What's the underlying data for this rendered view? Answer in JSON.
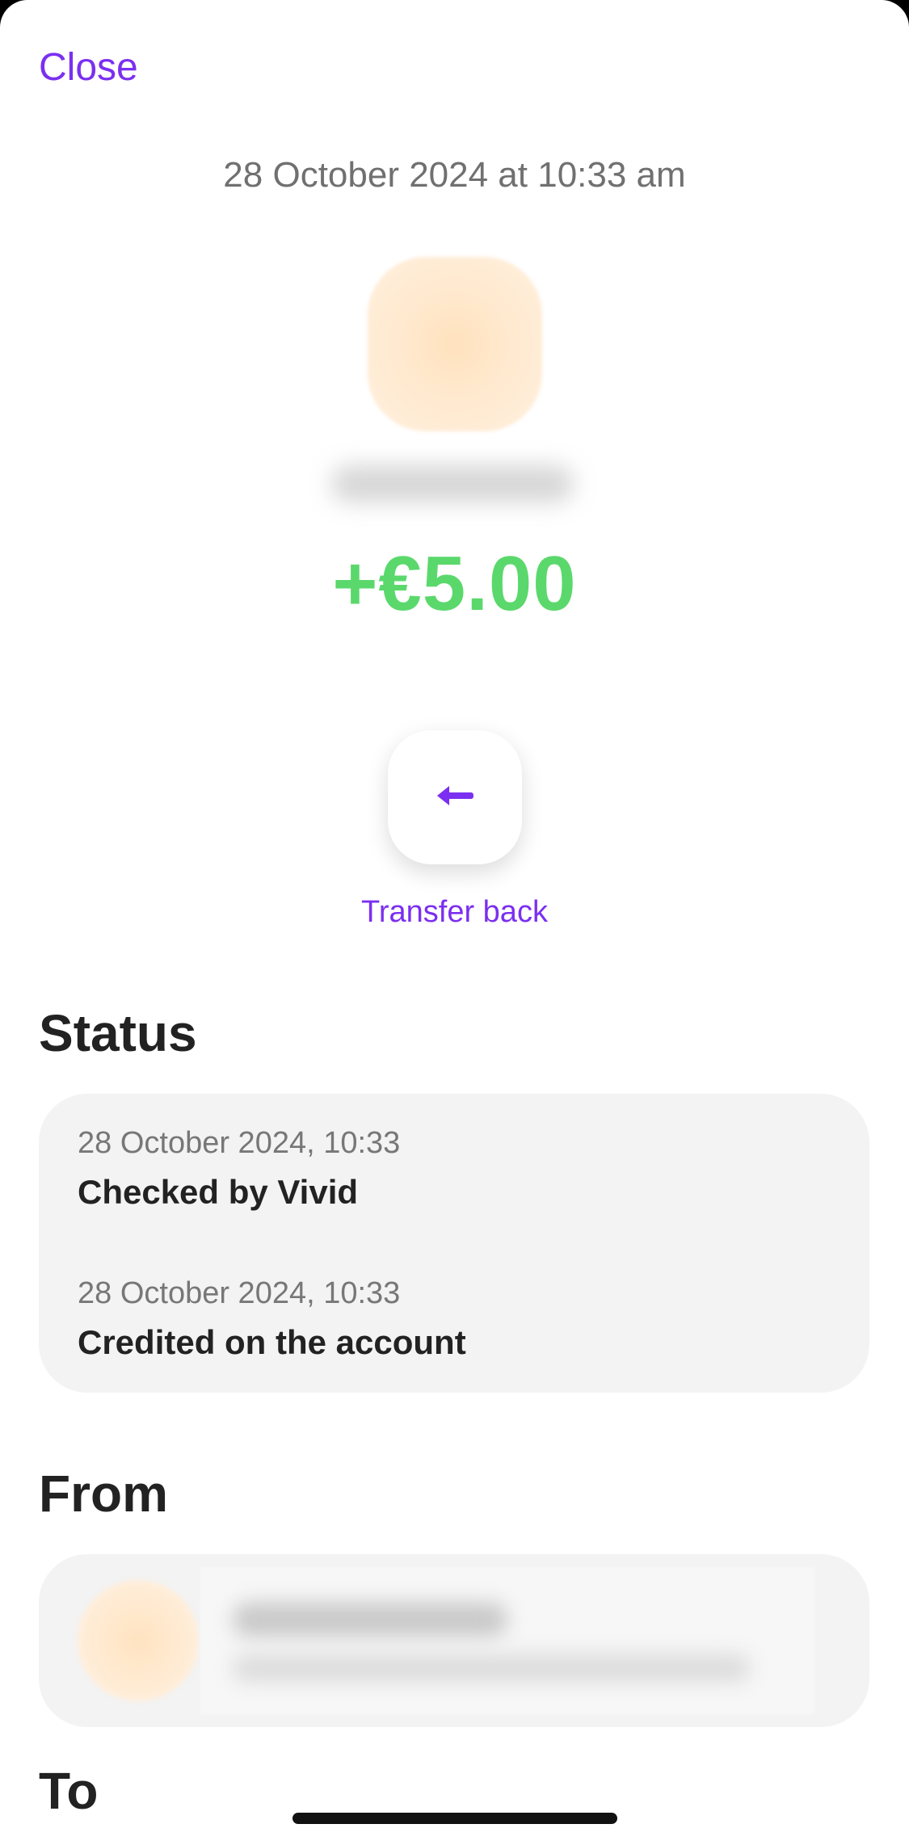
{
  "header": {
    "close_label": "Close",
    "datetime": "28 October 2024 at 10:33 am"
  },
  "transaction": {
    "amount": "+€5.00"
  },
  "actions": {
    "transfer_back_label": "Transfer back",
    "transfer_back_icon": "arrow-left-icon"
  },
  "status": {
    "title": "Status",
    "events": [
      {
        "date": "28 October 2024, 10:33",
        "text": "Checked by Vivid"
      },
      {
        "date": "28 October 2024, 10:33",
        "text": "Credited on the account"
      }
    ]
  },
  "from": {
    "title": "From"
  },
  "to": {
    "title": "To"
  },
  "colors": {
    "accent": "#7b2ff0",
    "amount_positive": "#5bd86c",
    "card_bg": "#f3f3f3"
  }
}
